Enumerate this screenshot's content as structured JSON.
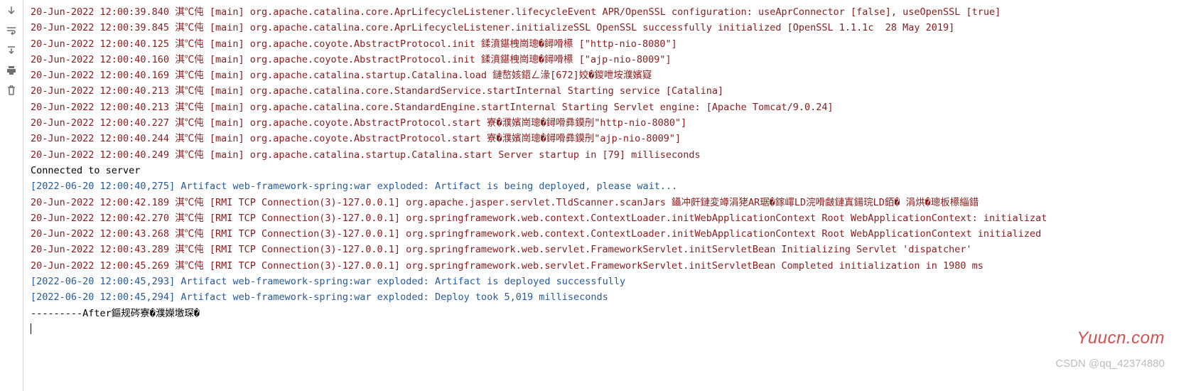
{
  "gutter": {
    "down": "scroll-down-icon",
    "wrap": "soft-wrap-icon",
    "scrollto": "scroll-to-end-icon",
    "print": "print-icon",
    "trash": "clear-all-icon"
  },
  "watermarks": {
    "site": "Yuucn.com",
    "csdn": "CSDN @qq_42374880"
  },
  "lines": [
    {
      "cls": "reddish",
      "text": "20-Jun-2022 12:00:39.840 淇℃伅 [main] org.apache.catalina.core.AprLifecycleListener.lifecycleEvent APR/OpenSSL configuration: useAprConnector [false], useOpenSSL [true]"
    },
    {
      "cls": "reddish",
      "text": "20-Jun-2022 12:00:39.845 淇℃伅 [main] org.apache.catalina.core.AprLifecycleListener.initializeSSL OpenSSL successfully initialized [OpenSSL 1.1.1c  28 May 2019]"
    },
    {
      "cls": "reddish",
      "text": "20-Jun-2022 12:00:40.125 淇℃伅 [main] org.apache.coyote.AbstractProtocol.init 鍒濆鍖栧崗璁�鐞嗗櫒 [\"http-nio-8080\"]"
    },
    {
      "cls": "reddish",
      "text": "20-Jun-2022 12:00:40.160 淇℃伅 [main] org.apache.coyote.AbstractProtocol.init 鍒濆鍖栧崗璁�鐞嗗櫒 [\"ajp-nio-8009\"]"
    },
    {
      "cls": "reddish",
      "text": "20-Jun-2022 12:00:40.169 淇℃伅 [main] org.apache.catalina.startup.Catalina.load 鏈嶅姟鍣ㄥ湪[672]姣�鍐呭垵濮嬪寲"
    },
    {
      "cls": "reddish",
      "text": "20-Jun-2022 12:00:40.213 淇℃伅 [main] org.apache.catalina.core.StandardService.startInternal Starting service [Catalina]"
    },
    {
      "cls": "reddish",
      "text": "20-Jun-2022 12:00:40.213 淇℃伅 [main] org.apache.catalina.core.StandardEngine.startInternal Starting Servlet engine: [Apache Tomcat/9.0.24]"
    },
    {
      "cls": "reddish",
      "text": "20-Jun-2022 12:00:40.227 淇℃伅 [main] org.apache.coyote.AbstractProtocol.start 寮�濮嬪崗璁�鐞嗗彞鏌刐\"http-nio-8080\"]"
    },
    {
      "cls": "reddish",
      "text": "20-Jun-2022 12:00:40.244 淇℃伅 [main] org.apache.coyote.AbstractProtocol.start 寮�濮嬪崗璁�鐞嗗彞鏌刐\"ajp-nio-8009\"]"
    },
    {
      "cls": "reddish",
      "text": "20-Jun-2022 12:00:40.249 淇℃伅 [main] org.apache.catalina.startup.Catalina.start Server startup in [79] milliseconds"
    },
    {
      "cls": "black",
      "text": "Connected to server"
    },
    {
      "cls": "blueish",
      "text": "[2022-06-20 12:00:40,275] Artifact web-framework-spring:war exploded: Artifact is being deployed, please wait..."
    },
    {
      "cls": "reddish",
      "text": "20-Jun-2022 12:00:42.189 淇℃伅 [RMI TCP Connection(3)-127.0.0.1] org.apache.jasper.servlet.TldScanner.scanJars 鑷冲皯鏈変竴涓狫AR琚�鎵嶵LD浣嗗皻鏈寘鍚琓LD銆� 涓烘�璁板櫒緇錯"
    },
    {
      "cls": "reddish",
      "text": "20-Jun-2022 12:00:42.270 淇℃伅 [RMI TCP Connection(3)-127.0.0.1] org.springframework.web.context.ContextLoader.initWebApplicationContext Root WebApplicationContext: initializat"
    },
    {
      "cls": "reddish",
      "text": "20-Jun-2022 12:00:43.268 淇℃伅 [RMI TCP Connection(3)-127.0.0.1] org.springframework.web.context.ContextLoader.initWebApplicationContext Root WebApplicationContext initialized"
    },
    {
      "cls": "reddish",
      "text": "20-Jun-2022 12:00:43.289 淇℃伅 [RMI TCP Connection(3)-127.0.0.1] org.springframework.web.servlet.FrameworkServlet.initServletBean Initializing Servlet 'dispatcher'"
    },
    {
      "cls": "reddish",
      "text": "20-Jun-2022 12:00:45.269 淇℃伅 [RMI TCP Connection(3)-127.0.0.1] org.springframework.web.servlet.FrameworkServlet.initServletBean Completed initialization in 1980 ms"
    },
    {
      "cls": "blueish",
      "text": "[2022-06-20 12:00:45,293] Artifact web-framework-spring:war exploded: Artifact is deployed successfully"
    },
    {
      "cls": "blueish",
      "text": "[2022-06-20 12:00:45,294] Artifact web-framework-spring:war exploded: Deploy took 5,019 milliseconds"
    },
    {
      "cls": "black",
      "text": "---------After鏂规硶寮�濮嬫墽琛�"
    }
  ]
}
